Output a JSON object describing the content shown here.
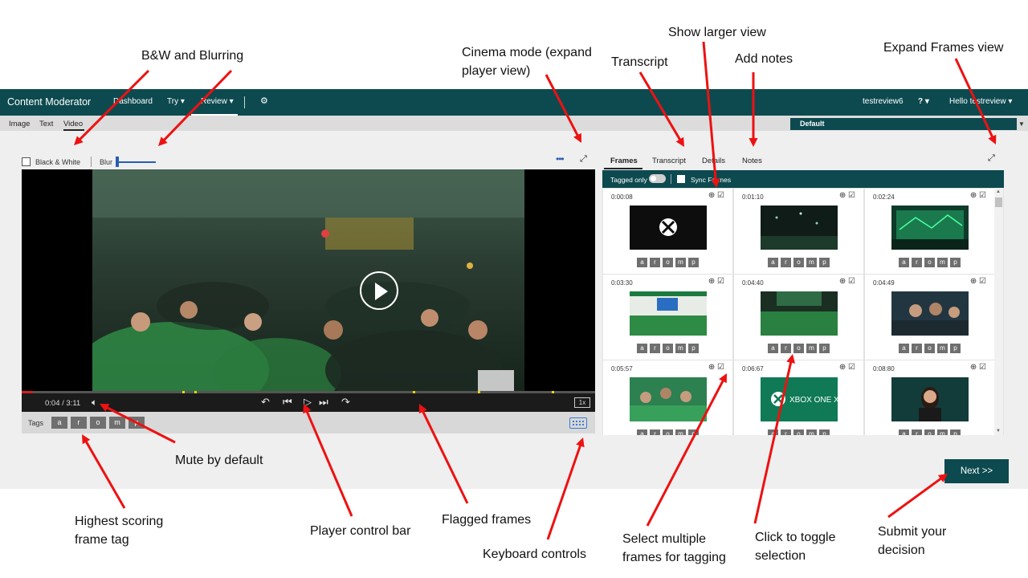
{
  "annotations": {
    "bw_blur": "B&W and Blurring",
    "cinema": "Cinema mode (expand\nplayer view)",
    "show_larger": "Show larger view",
    "transcript": "Transcript",
    "add_notes": "Add notes",
    "expand_frames": "Expand Frames view",
    "mute": "Mute by default",
    "highest_tag": "Highest scoring\nframe tag",
    "control_bar": "Player control bar",
    "flagged": "Flagged frames",
    "keyboard": "Keyboard controls",
    "select_multiple": "Select multiple\nframes for tagging",
    "toggle_selection": "Click to toggle\nselection",
    "submit": "Submit your\ndecision"
  },
  "app": {
    "brand": "Content Moderator",
    "nav": [
      "Dashboard",
      "Try ▾",
      "Review ▾"
    ],
    "settings_icon": "gear-icon",
    "user_review": "testreview6",
    "help": "? ▾",
    "greeting": "Hello testreview ▾",
    "subnav": [
      "Image",
      "Text",
      "Video"
    ],
    "team_select": "Default"
  },
  "controls": {
    "bw_label": "Black & White",
    "blur_label": "Blur"
  },
  "player": {
    "time": "0:04 / 3:11",
    "speed": "1x",
    "progress_fraction": 0.02
  },
  "tags_bar": {
    "label": "Tags",
    "tags": [
      "a",
      "r",
      "o",
      "m",
      "p"
    ]
  },
  "panel": {
    "tabs": [
      "Frames",
      "Transcript",
      "Details",
      "Notes"
    ],
    "tagged_only": "Tagged only",
    "sync_frames": "Sync Frames"
  },
  "frames": [
    {
      "time": "0:00:08"
    },
    {
      "time": "0:01:10"
    },
    {
      "time": "0:02:24"
    },
    {
      "time": "0:03:30"
    },
    {
      "time": "0:04:40"
    },
    {
      "time": "0:04:49"
    },
    {
      "time": "0:05:57"
    },
    {
      "time": "0:06:67"
    },
    {
      "time": "0:08:80"
    }
  ],
  "frame_thumb_text": "XBOX ONE X",
  "next_button": "Next >>",
  "colors": {
    "header": "#0c4a4f",
    "arrow": "#ee1111",
    "tag": "#6f6f6f",
    "accent_blue": "#2a5db0"
  }
}
